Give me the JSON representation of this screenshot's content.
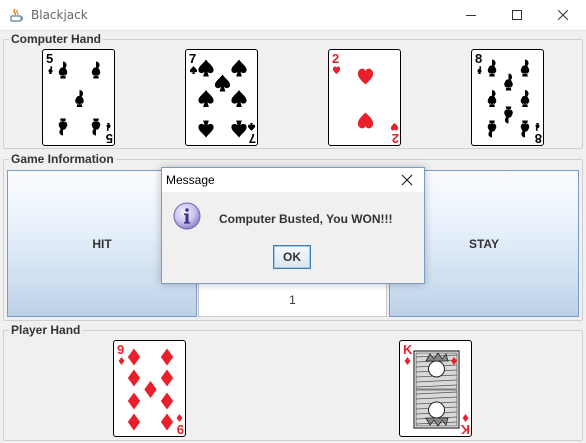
{
  "window": {
    "title": "Blackjack",
    "icon": "java-icon"
  },
  "computer_hand": {
    "label": "Computer Hand",
    "cards": [
      {
        "rank": "5",
        "suit": "clubs",
        "color": "#000000"
      },
      {
        "rank": "7",
        "suit": "spades",
        "color": "#000000"
      },
      {
        "rank": "2",
        "suit": "hearts",
        "color": "#e8202a"
      },
      {
        "rank": "8",
        "suit": "clubs",
        "color": "#000000"
      }
    ]
  },
  "game_info": {
    "label": "Game Information",
    "hit_label": "HIT",
    "stay_label": "STAY",
    "count_value": "1"
  },
  "player_hand": {
    "label": "Player Hand",
    "cards": [
      {
        "rank": "9",
        "suit": "diamonds",
        "color": "#e8202a"
      },
      {
        "rank": "K",
        "suit": "diamonds",
        "color": "#e8202a"
      }
    ]
  },
  "dialog": {
    "title": "Message",
    "message": "Computer Busted, You WON!!!",
    "ok_label": "OK",
    "icon": "info-icon"
  }
}
